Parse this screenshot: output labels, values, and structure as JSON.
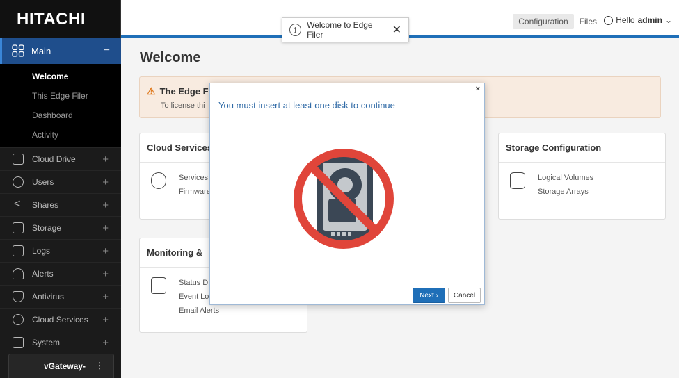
{
  "brand": {
    "name": "HITACHI"
  },
  "topbar": {
    "tabs": [
      {
        "label": "Configuration",
        "active": true
      },
      {
        "label": "Files",
        "active": false
      }
    ],
    "user_greeting": "Hello",
    "user_name": "admin",
    "menu_caret": "⌄"
  },
  "toast": {
    "icon_text": "i",
    "message": "Welcome to Edge Filer",
    "close": "✕"
  },
  "sidebar": {
    "main": {
      "label": "Main",
      "toggle": "−"
    },
    "sub_items": [
      {
        "label": "Welcome",
        "active": true
      },
      {
        "label": "This Edge Filer",
        "active": false
      },
      {
        "label": "Dashboard",
        "active": false
      },
      {
        "label": "Activity",
        "active": false
      }
    ],
    "items": [
      {
        "label": "Cloud Drive",
        "icon": "cloud-drive-icon",
        "toggle": "+"
      },
      {
        "label": "Users",
        "icon": "users-icon",
        "toggle": "+"
      },
      {
        "label": "Shares",
        "icon": "share-icon",
        "toggle": "+"
      },
      {
        "label": "Storage",
        "icon": "storage-icon",
        "toggle": "+"
      },
      {
        "label": "Logs",
        "icon": "logs-icon",
        "toggle": "+"
      },
      {
        "label": "Alerts",
        "icon": "bell-icon",
        "toggle": "+"
      },
      {
        "label": "Antivirus",
        "icon": "shield-icon",
        "toggle": "+"
      },
      {
        "label": "Cloud Services",
        "icon": "cloud-gear-icon",
        "toggle": "+"
      },
      {
        "label": "System",
        "icon": "system-icon",
        "toggle": "+"
      }
    ],
    "gateway": {
      "name": "vGateway-",
      "menu": "⋮"
    }
  },
  "main": {
    "title": "Welcome",
    "warning": {
      "title": "The Edge F",
      "text": "To license thi"
    },
    "cards": {
      "cloud_services": {
        "title": "Cloud Services",
        "links": [
          "Services",
          "Firmware"
        ]
      },
      "storage_configuration": {
        "title": "Storage Configuration",
        "links": [
          "Logical Volumes",
          "Storage Arrays"
        ]
      },
      "monitoring": {
        "title": "Monitoring &",
        "links": [
          "Status D",
          "Event Lo",
          "Email Alerts"
        ]
      }
    }
  },
  "modal": {
    "close": "×",
    "title": "You must insert at least one disk to continue",
    "next_label": "Next ›",
    "cancel_label": "Cancel",
    "colors": {
      "prohibit": "#e0453a",
      "disk_body": "#3b4755",
      "disk_face": "#c4c8cc"
    }
  }
}
